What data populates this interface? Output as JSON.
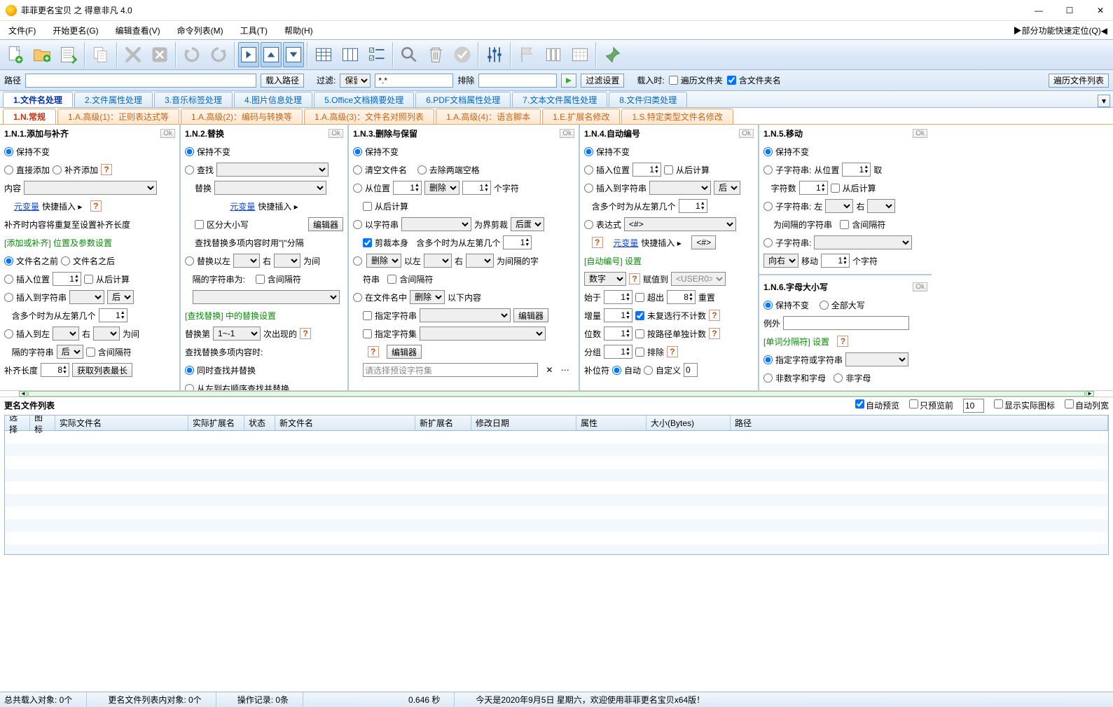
{
  "titlebar": {
    "title": "菲菲更名宝贝 之 得意非凡 4.0"
  },
  "menu": {
    "file": "文件(F)",
    "start": "开始更名(G)",
    "editview": "编辑查看(V)",
    "cmdlist": "命令列表(M)",
    "tools": "工具(T)",
    "help": "帮助(H)",
    "quick": "▶部分功能快速定位(Q)◀"
  },
  "pathbar": {
    "path_label": "路径",
    "load_path": "载入路径",
    "filter_label": "过滤:",
    "keep": "保留",
    "filter_pattern": "*.*",
    "exclude": "排除",
    "filter_settings": "过滤设置",
    "onload": "载入时:",
    "recurse": "遍历文件夹",
    "incl_folder": "含文件夹名",
    "traverse_list": "遍历文件列表"
  },
  "tabs": {
    "t1": "1.文件名处理",
    "t2": "2.文件属性处理",
    "t3": "3.音乐标签处理",
    "t4": "4.图片信息处理",
    "t5": "5.Office文档摘要处理",
    "t6": "6.PDF文档属性处理",
    "t7": "7.文本文件属性处理",
    "t8": "8.文件归类处理"
  },
  "subtabs": {
    "s1": "1.N.常规",
    "s2": "1.A.高级(1)：正则表达式等",
    "s3": "1.A.高级(2)：编码与转换等",
    "s4": "1.A.高级(3)：文件名对照列表",
    "s5": "1.A.高级(4)：语言脚本",
    "s6": "1.E.扩展名修改",
    "s7": "1.S.特定类型文件名修改"
  },
  "ok": "Ok",
  "p1": {
    "title": "1.N.1.添加与补齐",
    "keep": "保持不变",
    "direct_add": "直接添加",
    "pad_add": "补齐添加",
    "content": "内容",
    "meta_var": "元变量",
    "quick_insert": "快捷插入 ▸",
    "pad_note": "补齐时内容将重复至设置补齐长度",
    "sec_hdr": "[添加或补齐] 位置及参数设置",
    "before_name": "文件名之前",
    "after_name": "文件名之后",
    "ins_pos": "插入位置",
    "pos_val": "1",
    "from_end": "从后计算",
    "ins_to_str": "插入到字符串",
    "after": "后",
    "multi_note": "含多个时为从左第几个",
    "multi_val": "1",
    "ins_between": "插入到左",
    "right": "右",
    "between": "为间",
    "sep_str": "隔的字符串",
    "after2": "后",
    "incl_sep": "含间隔符",
    "pad_len": "补齐长度",
    "pad_val": "8",
    "get_max": "获取列表最长"
  },
  "p2": {
    "title": "1.N.2.替换",
    "keep": "保持不变",
    "find": "查找",
    "replace": "替换",
    "meta_var": "元变量",
    "quick_insert": "快捷插入 ▸",
    "case": "区分大小写",
    "editor": "编辑器",
    "multi_note": "查找替换多项内容时用\"|\"分隔",
    "repl_between": "替换以左",
    "right": "右",
    "between": "为间",
    "sep_str": "隔的字符串为:",
    "incl_sep": "含间隔符",
    "sec_hdr": "[查找替换] 中的替换设置",
    "repl_nth": "替换第",
    "range": "1~-1",
    "occur": "次出现的",
    "multi_find_note": "查找替换多项内容时:",
    "simul": "同时查找并替换",
    "seq": "从左到右顺序查找并替换"
  },
  "p3": {
    "title": "1.N.3.删除与保留",
    "keep": "保持不变",
    "clear": "清空文件名",
    "trim": "去除两端空格",
    "from_pos": "从位置",
    "pos_val": "1",
    "del": "删除",
    "cnt_val": "1",
    "chars": "个字符",
    "from_end": "从后计算",
    "by_str": "以字符串",
    "trim_by": "为界剪裁",
    "side": "后面",
    "trim_self": "剪裁本身",
    "multi_note": "含多个时为从左第几个",
    "multi_val": "1",
    "del_between": "删除",
    "left": "以左",
    "right": "右",
    "between": "为间隔的字",
    "sep": "符串",
    "incl_sep": "含间隔符",
    "in_name": "在文件名中",
    "del2": "删除",
    "below": "以下内容",
    "spec_str": "指定字符串",
    "editor": "编辑器",
    "spec_set": "指定字符集",
    "editor2": "编辑器",
    "preset": "请选择预设字符集"
  },
  "p4": {
    "title": "1.N.4.自动编号",
    "keep": "保持不变",
    "ins_pos": "插入位置",
    "pos_val": "1",
    "from_end": "从后计算",
    "ins_to_str": "插入到字符串",
    "after": "后",
    "multi_note": "含多个时为从左第几个",
    "multi_val": "1",
    "expr": "表达式",
    "expr_val": "<#>",
    "meta_var": "元变量",
    "quick_insert": "快捷插入 ▸",
    "ins_num": "<#>",
    "sec_hdr": "[自动编号] 设置",
    "type": "数字",
    "assign": "赋值到",
    "user": "<USER0>",
    "start": "始于",
    "start_val": "1",
    "exceed": "超出",
    "exceed_val": "8",
    "reset": "重置",
    "incr": "增量",
    "incr_val": "1",
    "skip_dup": "未复选行不计数",
    "digits": "位数",
    "digits_val": "1",
    "per_path": "按路径单独计数",
    "group": "分组",
    "group_val": "1",
    "excl": "排除",
    "pad": "补位符",
    "auto": "自动",
    "custom": "自定义",
    "custom_val": "0"
  },
  "p5": {
    "title": "1.N.5.移动",
    "keep": "保持不变",
    "sub_from": "子字符串:",
    "from_pos": "从位置",
    "pos_val": "1",
    "take": "取",
    "char_cnt": "字符数",
    "cnt_val": "1",
    "from_end": "从后计算",
    "sub_lr": "子字符串:",
    "left": "左",
    "right": "右",
    "sep_str": "为间隔的字符串",
    "incl_sep": "含间隔符",
    "sub_str": "子字符串:",
    "dir": "向右",
    "move": "移动",
    "move_val": "1",
    "chars": "个字符"
  },
  "p6": {
    "title": "1.N.6.字母大小写",
    "keep": "保持不变",
    "all_upper": "全部大写",
    "except": "例外",
    "sec_hdr": "[单词分隔符] 设置",
    "spec": "指定字符或字符串",
    "non_alnum": "非数字和字母",
    "non_alpha": "非字母"
  },
  "filelist": {
    "title": "更名文件列表",
    "auto_preview": "自动预览",
    "only_first": "只预览前",
    "only_val": "10",
    "show_icon": "显示实际图标",
    "auto_width": "自动列宽",
    "cols": {
      "sel": "选择",
      "icon": "图标",
      "name": "实际文件名",
      "ext": "实际扩展名",
      "status": "状态",
      "newname": "新文件名",
      "newext": "新扩展名",
      "mdate": "修改日期",
      "attr": "属性",
      "size": "大小(Bytes)",
      "path": "路径"
    }
  },
  "status": {
    "loaded": "总共载入对象: 0个",
    "inlist": "更名文件列表内对象: 0个",
    "ops": "操作记录: 0条",
    "time": "0.646 秒",
    "today": "今天是2020年9月5日 星期六，欢迎使用菲菲更名宝贝x64版！"
  }
}
